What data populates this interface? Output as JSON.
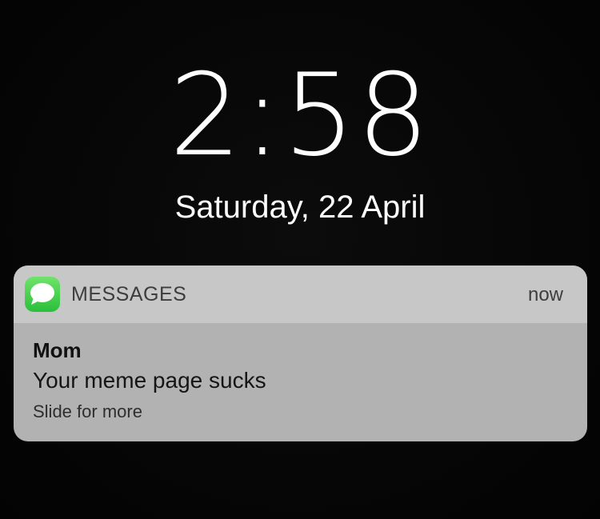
{
  "lockscreen": {
    "time": "2:58",
    "date": "Saturday, 22 April"
  },
  "notification": {
    "app_icon": "messages-icon",
    "app_name": "MESSAGES",
    "time_ago": "now",
    "sender": "Mom",
    "message": "Your meme page sucks",
    "hint": "Slide for more",
    "colors": {
      "icon_green": "#34c74a",
      "panel": "#b2b2b2",
      "header": "#c7c7c7"
    }
  }
}
